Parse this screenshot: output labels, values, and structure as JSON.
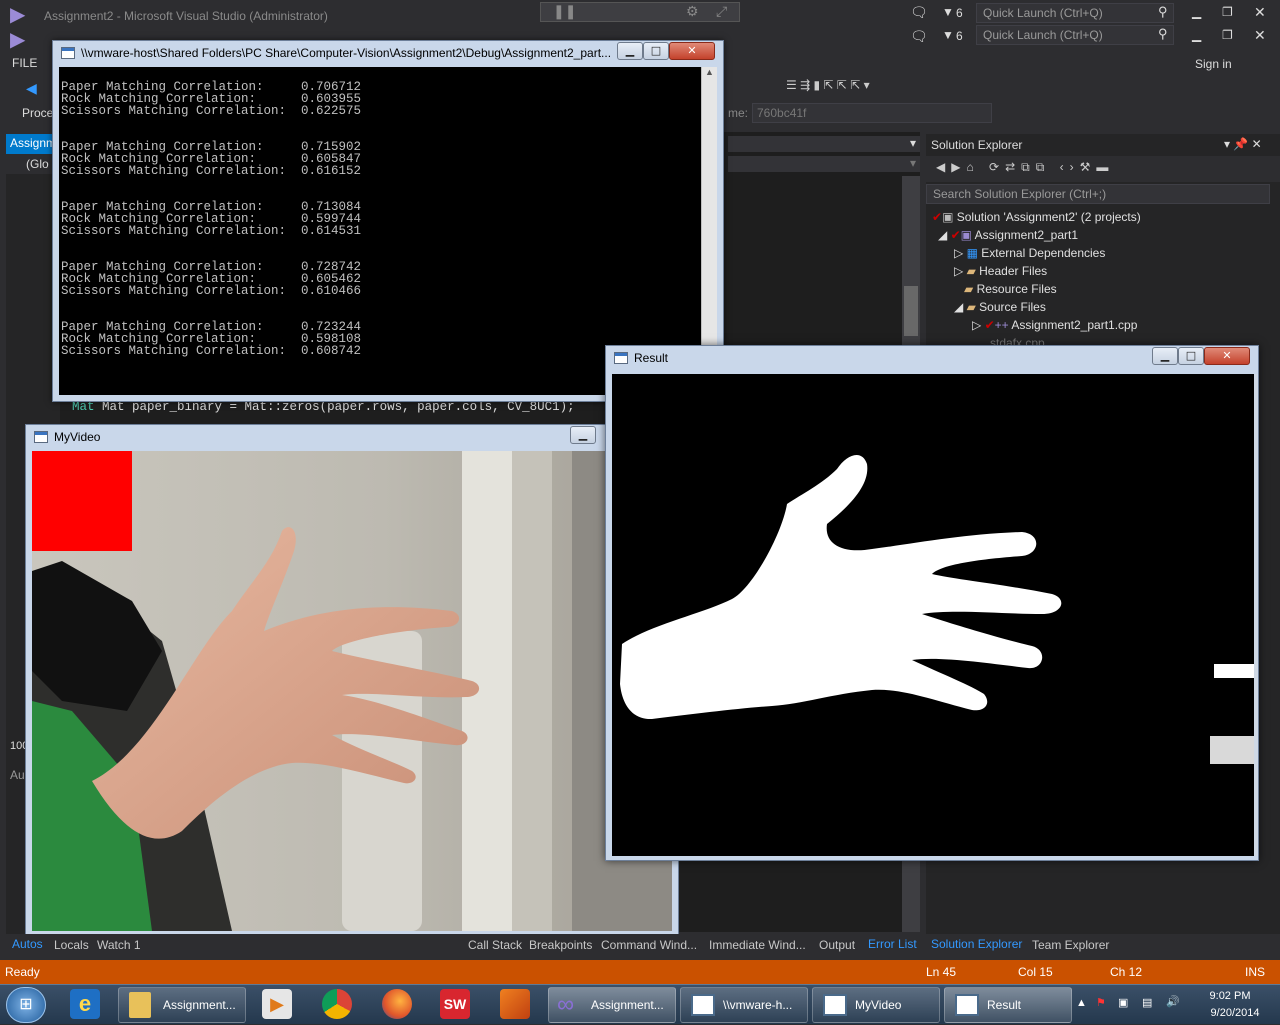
{
  "vs": {
    "title1": "Assignment2 - Microsoft Visual Studio (Administrator)",
    "notif_count1": "6",
    "notif_count2": "6",
    "quick_launch": "Quick Launch (Ctrl+Q)",
    "menu_file": "FILE",
    "sign_in": "Sign in",
    "process_label": "Proce",
    "frame_label": "me:",
    "frame_value": "760bc41f",
    "doc_tab": "Assignm",
    "scope": "(Glo",
    "code_line": "Mat paper_binary = Mat::zeros(paper.rows, paper.cols, CV_8UC1);",
    "left_stub1": "100",
    "left_stub2": "Au"
  },
  "console": {
    "title": "\\\\vmware-host\\Shared Folders\\PC Share\\Computer-Vision\\Assignment2\\Debug\\Assignment2_part...",
    "groups": [
      {
        "paper": "0.706712",
        "rock": "0.603955",
        "scissors": "0.622575"
      },
      {
        "paper": "0.715902",
        "rock": "0.605847",
        "scissors": "0.616152"
      },
      {
        "paper": "0.713084",
        "rock": "0.599744",
        "scissors": "0.614531"
      },
      {
        "paper": "0.728742",
        "rock": "0.605462",
        "scissors": "0.610466"
      },
      {
        "paper": "0.723244",
        "rock": "0.598108",
        "scissors": "0.608742"
      }
    ],
    "label_paper": "Paper Matching Correlation:",
    "label_rock": "Rock Matching Correlation:",
    "label_scissors": "Scissors Matching Correlation:"
  },
  "video": {
    "title": "MyVideo"
  },
  "result": {
    "title": "Result"
  },
  "solution_explorer": {
    "title": "Solution Explorer",
    "search": "Search Solution Explorer (Ctrl+;)",
    "solution": "Solution 'Assignment2' (2 projects)",
    "project": "Assignment2_part1",
    "ext_deps": "External Dependencies",
    "header_files": "Header Files",
    "resource_files": "Resource Files",
    "source_files": "Source Files",
    "cpp_file": "Assignment2_part1.cpp",
    "stdafx": "stdafx.cpp"
  },
  "bottom_tabs": {
    "autos": "Autos",
    "locals": "Locals",
    "watch": "Watch 1",
    "call_stack": "Call Stack",
    "breakpoints": "Breakpoints",
    "command": "Command Wind...",
    "immediate": "Immediate Wind...",
    "output": "Output",
    "error_list": "Error List",
    "se_tab": "Solution Explorer",
    "team_tab": "Team Explorer"
  },
  "status": {
    "ready": "Ready",
    "ln": "Ln 45",
    "col": "Col 15",
    "ch": "Ch 12",
    "ins": "INS"
  },
  "taskbar": {
    "explorer_label": "Assignment...",
    "vs_label": "Assignment...",
    "console_label": "\\\\vmware-h...",
    "video_label": "MyVideo",
    "result_label": "Result",
    "time": "9:02 PM",
    "date": "9/20/2014"
  },
  "colors": {
    "status_bar": "#ca5100",
    "vs_bg": "#2d2d30",
    "accent_blue": "#3399ff"
  }
}
